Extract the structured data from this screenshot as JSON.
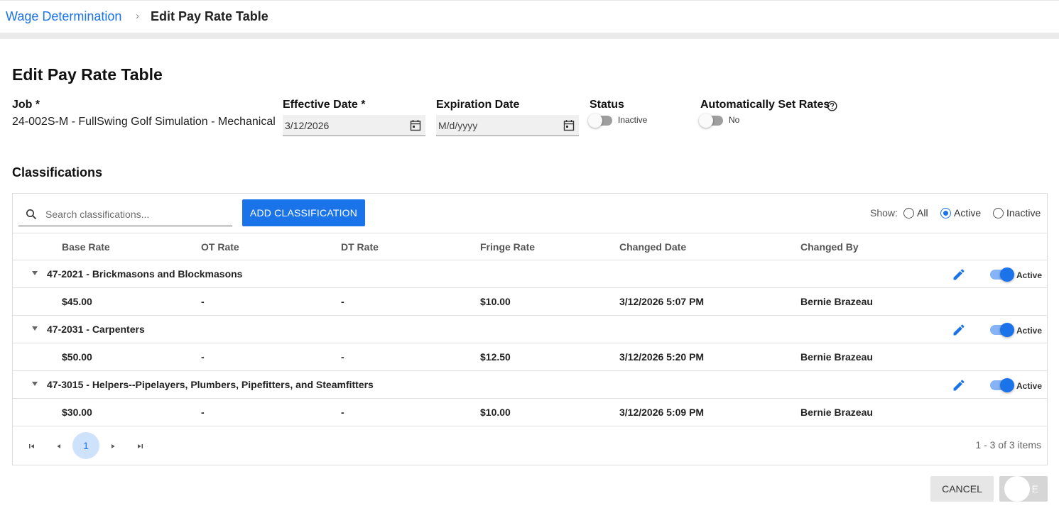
{
  "breadcrumb": {
    "parent": "Wage Determination",
    "separator": "›",
    "current": "Edit Pay Rate Table"
  },
  "page_title": "Edit Pay Rate Table",
  "form": {
    "job_label": "Job *",
    "job_value": "24-002S-M - FullSwing Golf Simulation - Mechanical",
    "effective_date_label": "Effective Date *",
    "effective_date_value": "3/12/2026",
    "expiration_date_label": "Expiration Date",
    "expiration_date_placeholder": "M/d/yyyy",
    "status_label": "Status",
    "status_value": "Inactive",
    "auto_rates_label": "Automatically Set Rates",
    "auto_rates_value": "No"
  },
  "classifications": {
    "title": "Classifications",
    "search_placeholder": "Search classifications...",
    "add_button": "ADD CLASSIFICATION",
    "show_label": "Show:",
    "filters": [
      "All",
      "Active",
      "Inactive"
    ],
    "selected_filter": "Active",
    "columns": [
      "Base Rate",
      "OT Rate",
      "DT Rate",
      "Fringe Rate",
      "Changed Date",
      "Changed By"
    ],
    "groups": [
      {
        "title": "47-2021 - Brickmasons and Blockmasons",
        "status": "Active",
        "row": {
          "base": "$45.00",
          "ot": "-",
          "dt": "-",
          "fringe": "$10.00",
          "changed_date": "3/12/2026 5:07 PM",
          "changed_by": "Bernie Brazeau"
        }
      },
      {
        "title": "47-2031 - Carpenters",
        "status": "Active",
        "row": {
          "base": "$50.00",
          "ot": "-",
          "dt": "-",
          "fringe": "$12.50",
          "changed_date": "3/12/2026 5:20 PM",
          "changed_by": "Bernie Brazeau"
        }
      },
      {
        "title": "47-3015 - Helpers--Pipelayers, Plumbers, Pipefitters, and Steamfitters",
        "status": "Active",
        "row": {
          "base": "$30.00",
          "ot": "-",
          "dt": "-",
          "fringe": "$10.00",
          "changed_date": "3/12/2026 5:09 PM",
          "changed_by": "Bernie Brazeau"
        }
      }
    ],
    "pager": {
      "current_page": "1",
      "info": "1 - 3 of 3 items"
    }
  },
  "footer": {
    "cancel": "CANCEL",
    "save": "E"
  },
  "colors": {
    "accent": "#1a73e8",
    "toggle_track_on": "#85b3f5",
    "page_highlight": "#cfe2fb"
  }
}
